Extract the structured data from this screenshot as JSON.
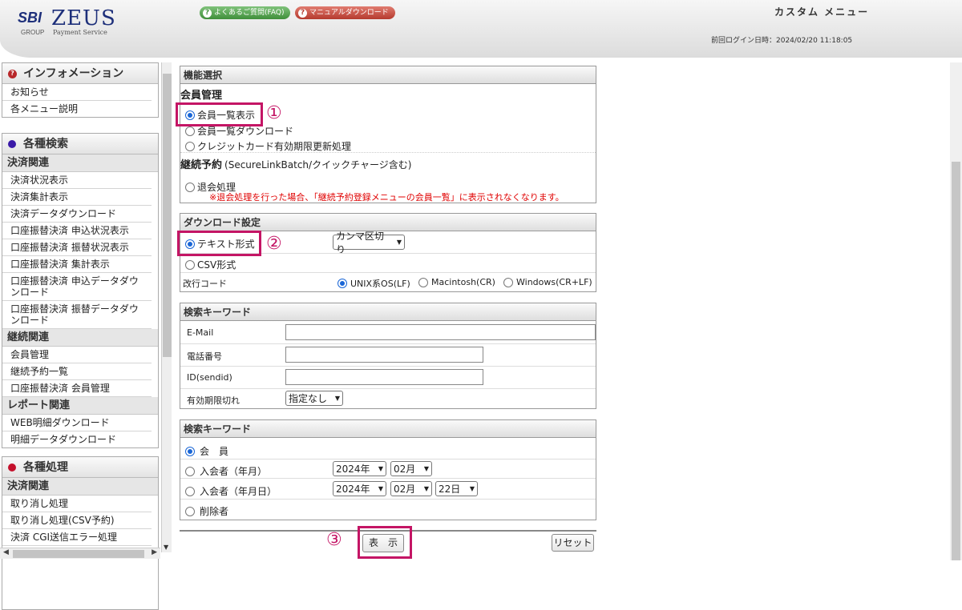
{
  "header": {
    "logo_sbi": "SBI",
    "logo_group": "GROUP",
    "logo_zeus": "ZEUS",
    "logo_payment_service": "Payment Service",
    "faq_button": "よくあるご質問(FAQ)",
    "manual_button": "マニュアルダウンロード",
    "custom_menu": "カスタム メニュー",
    "last_login": "前回ログイン日時：2024/02/20 11:18:05"
  },
  "sidebar": {
    "info": {
      "title": "インフォメーション",
      "items": [
        "お知らせ",
        "各メニュー説明"
      ]
    },
    "search": {
      "title": "各種検索",
      "cat1": "決済関連",
      "cat1_items": [
        "決済状況表示",
        "決済集計表示",
        "決済データダウンロード",
        "口座振替決済 申込状況表示",
        "口座振替決済 振替状況表示",
        "口座振替決済 集計表示",
        "口座振替決済 申込データダウンロード",
        "口座振替決済 振替データダウンロード"
      ],
      "cat2": "継続関連",
      "cat2_items": [
        "会員管理",
        "継続予約一覧",
        "口座振替決済 会員管理"
      ],
      "cat3": "レポート関連",
      "cat3_items": [
        "WEB明細ダウンロード",
        "明細データダウンロード"
      ]
    },
    "process": {
      "title": "各種処理",
      "cat1": "決済関連",
      "cat1_items": [
        "取り消し処理",
        "取り消し処理(CSV予約)",
        "決済 CGI送信エラー処理"
      ]
    }
  },
  "function_panel": {
    "title": "機能選択",
    "section_member": "会員管理",
    "opt_member_list": "会員一覧表示",
    "opt_member_download": "会員一覧ダウンロード",
    "opt_card_update": "クレジットカード有効期限更新処理",
    "section_continuation": "継続予約",
    "section_continuation_note": "(SecureLinkBatch/クイックチャージ含む)",
    "opt_withdraw": "退会処理",
    "withdraw_note": "※退会処理を行った場合、「継続予約登録メニューの会員一覧」に表示されなくなります。"
  },
  "download_panel": {
    "title": "ダウンロード設定",
    "opt_text": "テキスト形式",
    "text_separator": "カンマ区切り",
    "opt_csv": "CSV形式",
    "newline_label": "改行コード",
    "newline_options": [
      "UNIX系OS(LF)",
      "Macintosh(CR)",
      "Windows(CR+LF)"
    ]
  },
  "keyword_panel": {
    "title": "検索キーワード",
    "email_label": "E-Mail",
    "phone_label": "電話番号",
    "id_label": "ID(sendid)",
    "expiry_label": "有効期限切れ",
    "expiry_value": "指定なし"
  },
  "member_panel": {
    "title": "検索キーワード",
    "opt_member": "会　員",
    "opt_join_month": "入会者（年月）",
    "opt_join_date": "入会者（年月日）",
    "opt_withdrawn": "削除者",
    "year_value": "2024年",
    "month_value": "02月",
    "day_value": "22日"
  },
  "buttons": {
    "display": "表　示",
    "reset": "リセット"
  },
  "annotations": [
    "①",
    "②",
    "③"
  ],
  "colors": {
    "highlight": "#c41565",
    "note_red": "#e00000",
    "radio_blue": "#1a66d6"
  }
}
